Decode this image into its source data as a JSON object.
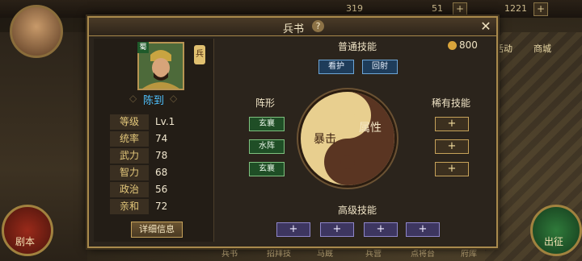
{
  "topbar": {
    "resource1": "319",
    "resource2": "51",
    "resource3": "1221"
  },
  "sidebar": {
    "right_label1": "活动",
    "right_label2": "商城",
    "left_bottom_label": "剧本",
    "right_bottom_label": "出征"
  },
  "bottom_tabs": [
    "兵书",
    "招拜技",
    "马厩",
    "兵营",
    "点将台",
    "府库"
  ],
  "dialog": {
    "title": "兵书",
    "help": "?",
    "close": "✕"
  },
  "hero": {
    "faction": "蜀",
    "troop": "兵",
    "name": "陈到",
    "stats": [
      {
        "label": "等级",
        "value": "Lv.1"
      },
      {
        "label": "统率",
        "value": "74"
      },
      {
        "label": "武力",
        "value": "78"
      },
      {
        "label": "智力",
        "value": "68"
      },
      {
        "label": "政治",
        "value": "56"
      },
      {
        "label": "亲和",
        "value": "72"
      }
    ],
    "detail_button": "详细信息"
  },
  "skills": {
    "normal_title": "普通技能",
    "gold": "800",
    "normal": [
      "看护",
      "回射"
    ],
    "formation_title": "阵形",
    "formations": [
      "玄襄",
      "水阵",
      "玄襄"
    ],
    "rare_title": "稀有技能",
    "rare": [
      "+",
      "+",
      "+"
    ],
    "advanced_title": "高级技能",
    "advanced": [
      "+",
      "+",
      "+",
      "+"
    ],
    "yin_label": "暴击",
    "yang_label": "属性"
  }
}
